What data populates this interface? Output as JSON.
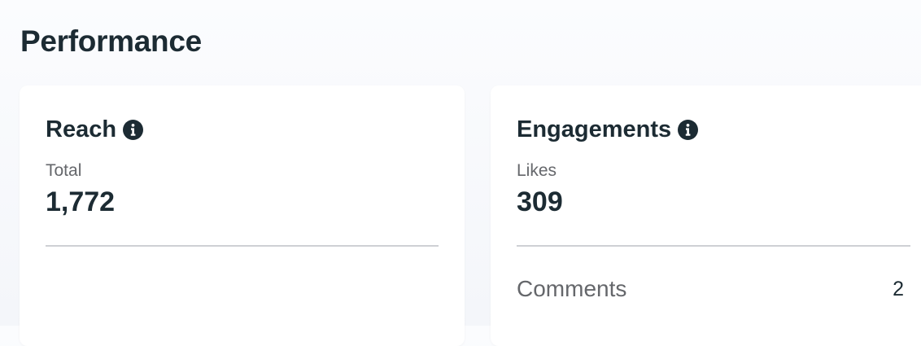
{
  "page": {
    "title": "Performance"
  },
  "reach": {
    "title": "Reach",
    "icon": "info-icon",
    "metric_label": "Total",
    "metric_value": "1,772"
  },
  "engagements": {
    "title": "Engagements",
    "icon": "info-icon",
    "metric_label": "Likes",
    "metric_value": "309",
    "rows": [
      {
        "label": "Comments",
        "value": "2"
      }
    ]
  },
  "colors": {
    "text_primary": "#1c2b33",
    "text_secondary": "#65676b",
    "divider": "#ced0d4",
    "card_background": "#ffffff"
  }
}
